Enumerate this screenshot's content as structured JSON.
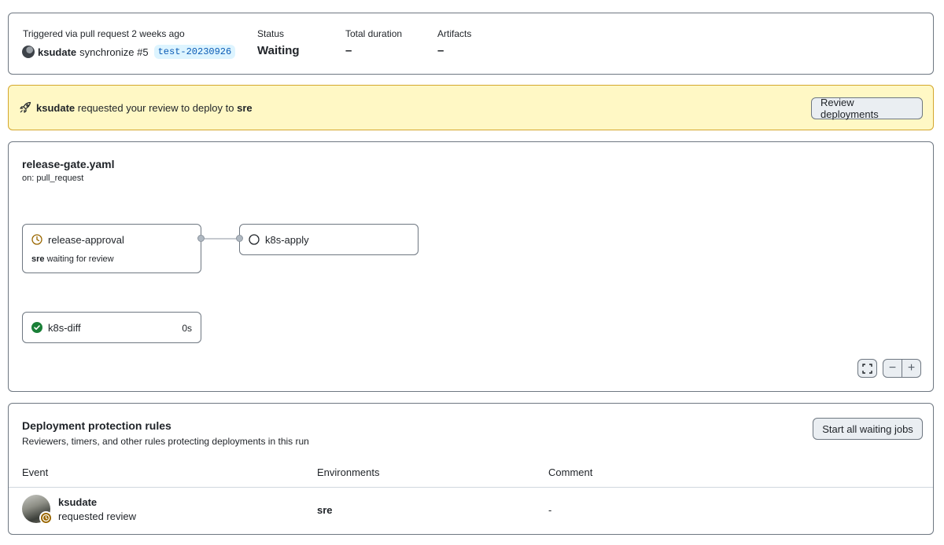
{
  "summary": {
    "trigger_text": "Triggered via pull request 2 weeks ago",
    "actor": "ksudate",
    "event": "synchronize #5",
    "branch": "test-20230926",
    "status_label": "Status",
    "status_value": "Waiting",
    "duration_label": "Total duration",
    "duration_value": "–",
    "artifacts_label": "Artifacts",
    "artifacts_value": "–"
  },
  "banner": {
    "actor": "ksudate",
    "text": "requested your review to deploy to",
    "environment": "sre",
    "button_label": "Review deployments"
  },
  "workflow": {
    "file": "release-gate.yaml",
    "trigger": "on: pull_request",
    "jobs": {
      "release_approval": {
        "name": "release-approval",
        "env": "sre",
        "sub": "waiting for review"
      },
      "k8s_apply": {
        "name": "k8s-apply"
      },
      "k8s_diff": {
        "name": "k8s-diff",
        "duration": "0s"
      }
    },
    "controls": {
      "zoom_out": "−",
      "zoom_in": "+"
    }
  },
  "rules": {
    "title": "Deployment protection rules",
    "subtitle": "Reviewers, timers, and other rules protecting deployments in this run",
    "button_label": "Start all waiting jobs",
    "columns": [
      "Event",
      "Environments",
      "Comment"
    ],
    "row": {
      "user": "ksudate",
      "action": "requested review",
      "environment": "sre",
      "comment": "-"
    }
  },
  "colors": {
    "banner_bg": "#fff8c5",
    "success": "#1a7f37",
    "waiting": "#9a6700",
    "branch_badge": "#ddf4ff"
  }
}
